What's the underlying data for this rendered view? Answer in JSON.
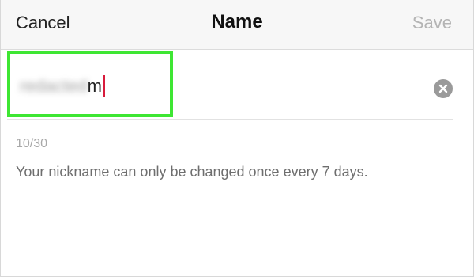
{
  "nav": {
    "cancel_label": "Cancel",
    "title": "Name",
    "save_label": "Save"
  },
  "name_field": {
    "blurred_value": "redacted",
    "visible_suffix": "m",
    "clear_icon": "clear-circle-x-icon",
    "highlight_color": "#3ee633"
  },
  "counter": "10/30",
  "hint": "Your nickname can only be changed once every 7 days."
}
